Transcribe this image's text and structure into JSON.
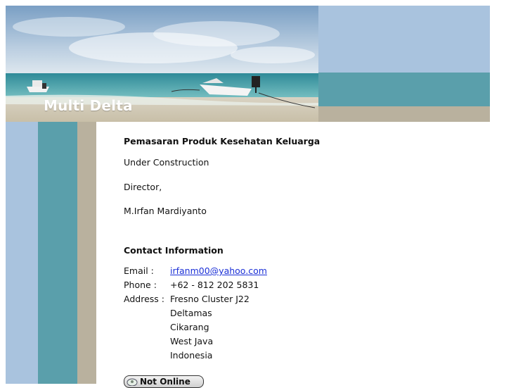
{
  "brand": {
    "name": "Multi Delta"
  },
  "page": {
    "subtitle": "Pemasaran Produk Kesehatan Keluarga",
    "status_text": "Under Construction",
    "role": "Director,",
    "person": "M.Irfan Mardiyanto"
  },
  "contact": {
    "heading": "Contact Information",
    "email_label": "Email :",
    "email_value": "irfanm00@yahoo.com",
    "phone_label": "Phone :",
    "phone_value": "+62 - 812 202 5831",
    "address_label": "Address :",
    "address_lines": [
      "Fresno Cluster J22",
      "Deltamas",
      "Cikarang",
      "West Java",
      "Indonesia"
    ]
  },
  "messenger": {
    "label": "Not Online",
    "icon": "messenger-status-icon"
  },
  "colors": {
    "stripe_blue": "#a9c3de",
    "stripe_teal": "#5a9fab",
    "stripe_tan": "#b9b19e",
    "link": "#1a2fd6"
  }
}
